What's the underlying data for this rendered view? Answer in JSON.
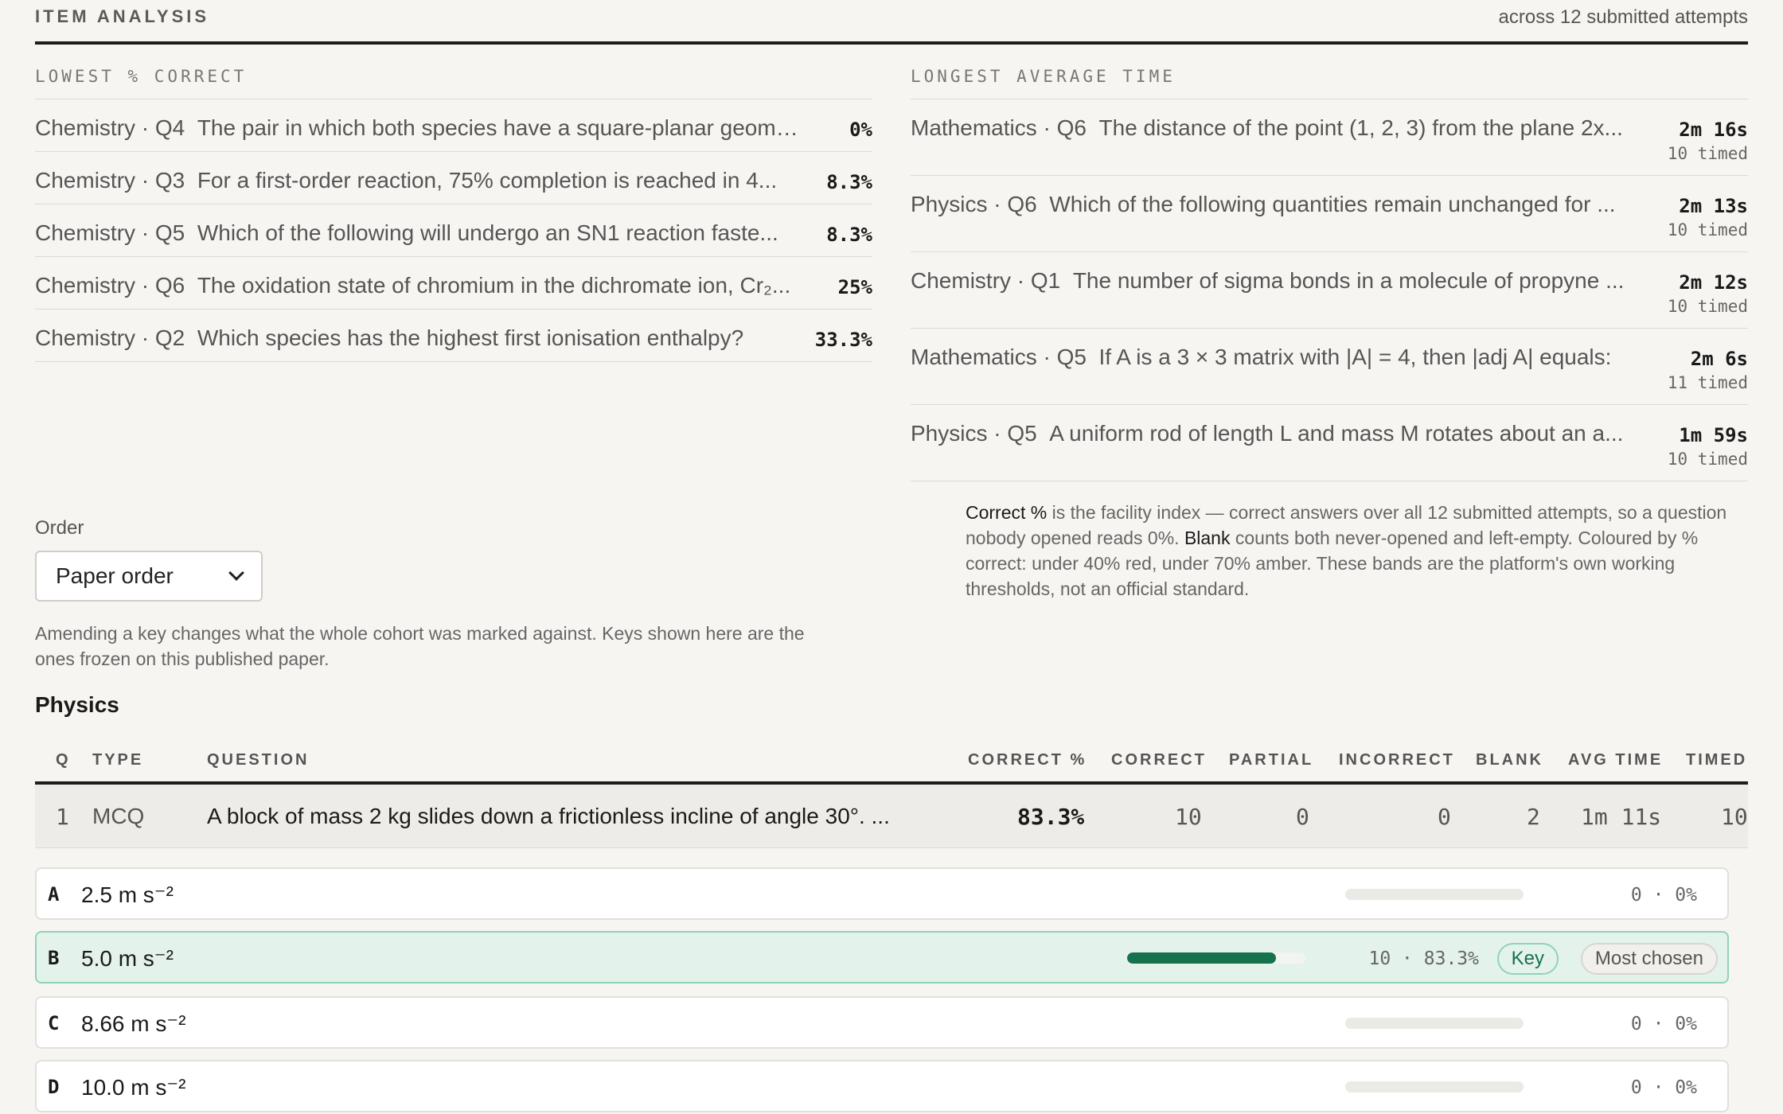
{
  "header": {
    "title": "ITEM ANALYSIS",
    "subtitle": "across 12 submitted attempts"
  },
  "lowest": {
    "heading": "LOWEST % CORRECT",
    "items": [
      {
        "subject": "Chemistry · Q4",
        "question": "The pair in which both species have a square-planar geome...",
        "pct": "0%"
      },
      {
        "subject": "Chemistry · Q3",
        "question": "For a first-order reaction, 75% completion is reached in 4...",
        "pct": "8.3%"
      },
      {
        "subject": "Chemistry · Q5",
        "question": "Which of the following will undergo an SN1 reaction faste...",
        "pct": "8.3%"
      },
      {
        "subject": "Chemistry · Q6",
        "question": "The oxidation state of chromium in the dichromate ion, Cr₂...",
        "pct": "25%"
      },
      {
        "subject": "Chemistry · Q2",
        "question": "Which species has the highest first ionisation enthalpy?",
        "pct": "33.3%"
      }
    ]
  },
  "longest": {
    "heading": "LONGEST AVERAGE TIME",
    "items": [
      {
        "subject": "Mathematics · Q6",
        "question": "The distance of the point (1, 2, 3) from the plane 2x...",
        "time": "2m 16s",
        "timed": "10 timed"
      },
      {
        "subject": "Physics · Q6",
        "question": "Which of the following quantities remain unchanged for ...",
        "time": "2m 13s",
        "timed": "10 timed"
      },
      {
        "subject": "Chemistry · Q1",
        "question": "The number of sigma bonds in a molecule of propyne ...",
        "time": "2m 12s",
        "timed": "10 timed"
      },
      {
        "subject": "Mathematics · Q5",
        "question": "If A is a 3 × 3 matrix with |A| = 4, then |adj A| equals:",
        "time": "2m 6s",
        "timed": "11 timed"
      },
      {
        "subject": "Physics · Q5",
        "question": "A uniform rod of length L and mass M rotates about an a...",
        "time": "1m 59s",
        "timed": "10 timed"
      }
    ]
  },
  "note": {
    "term1": "Correct %",
    "text1": " is the facility index — correct answers over all 12 submitted attempts, so a question nobody opened reads 0%. ",
    "term2": "Blank",
    "text2": " counts both never-opened and left-empty. Coloured by % correct: under 40% red, under 70% amber. These bands are the platform's own working thresholds, not an official standard."
  },
  "order": {
    "label": "Order",
    "selected": "Paper order"
  },
  "amend_note": "Amending a key changes what the whole cohort was marked against. Keys shown here are the ones frozen on this published paper.",
  "section": "Physics",
  "table": {
    "headers": {
      "q": "Q",
      "type": "TYPE",
      "question": "QUESTION",
      "correct_pct": "CORRECT %",
      "correct": "CORRECT",
      "partial": "PARTIAL",
      "incorrect": "INCORRECT",
      "blank": "BLANK",
      "avg_time": "AVG TIME",
      "timed": "TIMED"
    },
    "row": {
      "q": "1",
      "type": "MCQ",
      "question": "A block of mass 2 kg slides down a frictionless incline of angle 30°. ...",
      "correct_pct": "83.3%",
      "correct": "10",
      "partial": "0",
      "incorrect": "0",
      "blank": "2",
      "avg_time": "1m 11s",
      "timed": "10"
    }
  },
  "options": [
    {
      "letter": "A",
      "text": "2.5 m s⁻²",
      "count": "0 · 0%",
      "share": 0
    },
    {
      "letter": "B",
      "text": "5.0 m s⁻²",
      "count": "10 · 83.3%",
      "share": 0.833,
      "key": "Key",
      "most": "Most chosen"
    },
    {
      "letter": "C",
      "text": "8.66 m s⁻²",
      "count": "0 · 0%",
      "share": 0
    },
    {
      "letter": "D",
      "text": "10.0 m s⁻²",
      "count": "0 · 0%",
      "share": 0
    }
  ],
  "colors": {
    "accent_green": "#16714d",
    "key_border": "#8fd4b6",
    "correct_bg": "#e4f2ec"
  }
}
